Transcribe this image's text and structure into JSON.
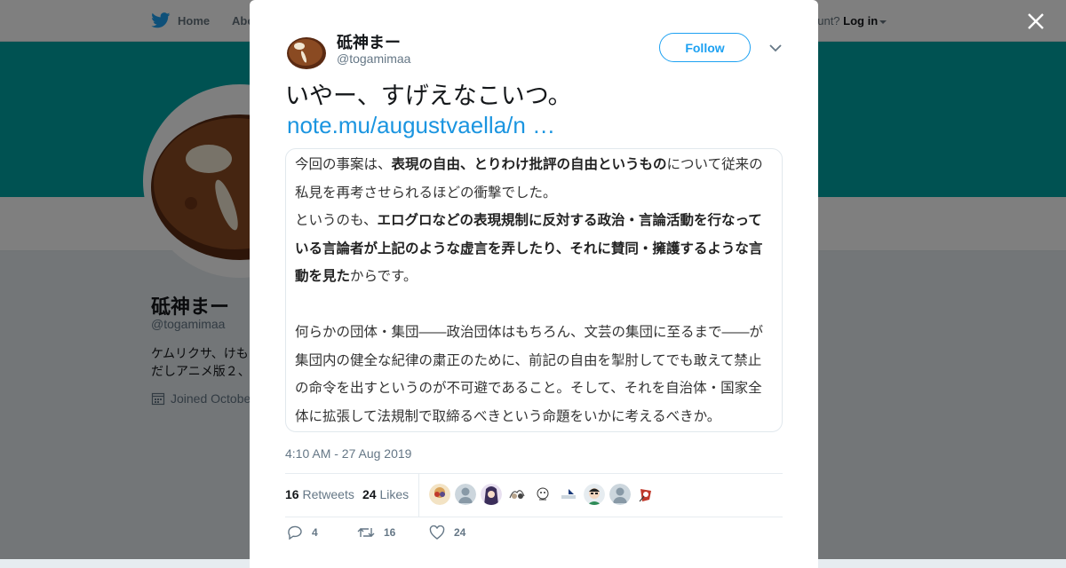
{
  "topbar": {
    "home_label": "Home",
    "about_label": "Abo",
    "account_prompt": "ccount?",
    "login_label": "Log in"
  },
  "profile": {
    "name": "砥神まー",
    "handle": "@togamimaa",
    "bio_line1": "ケムリクサ、けも",
    "bio_line2": "だしアニメ版２、",
    "joined": "Joined Octobe",
    "banner_color": "#00a5a5"
  },
  "tweet": {
    "author_name": "砥神まー",
    "author_handle": "@togamimaa",
    "follow_label": "Follow",
    "text": "いやー、すげえなこいつ。",
    "link": "note.mu/augustvaella/n …",
    "card": {
      "p1_pre": "今回の事案は、",
      "p1_bold": "表現の自由、とりわけ批評の自由というもの",
      "p1_post": "について従来の私見を再考させられるほどの衝撃でした。",
      "p2_pre": "というのも、",
      "p2_bold": "エログロなどの表現規制に反対する政治・言論活動を行なっている言論者が上記のような虚言を弄したり、それに賛同・擁護するような言動を見た",
      "p2_post": "からです。",
      "p3": "何らかの団体・集団――政治団体はもちろん、文芸の集団に至るまで――が集団内の健全な紀律の粛正のために、前記の自由を掣肘してでも敢えて禁止の命令を出すというのが不可避であること。そして、それを自治体・国家全体に拡張して法規制で取締るべきという命題をいかに考えるべきか。"
    },
    "timestamp": "4:10 AM - 27 Aug 2019",
    "retweets_count": "16",
    "retweets_label": "Retweets",
    "likes_count": "24",
    "likes_label": "Likes",
    "reply_count": "4",
    "retweet_count_action": "16",
    "like_count_action": "24"
  },
  "colors": {
    "accent": "#1da1f2",
    "link": "#1b95e0",
    "muted": "#657786"
  },
  "icons": [
    "twitter-bird-icon",
    "close-icon",
    "chevron-down-icon",
    "calendar-icon",
    "reply-icon",
    "retweet-icon",
    "heart-icon"
  ]
}
